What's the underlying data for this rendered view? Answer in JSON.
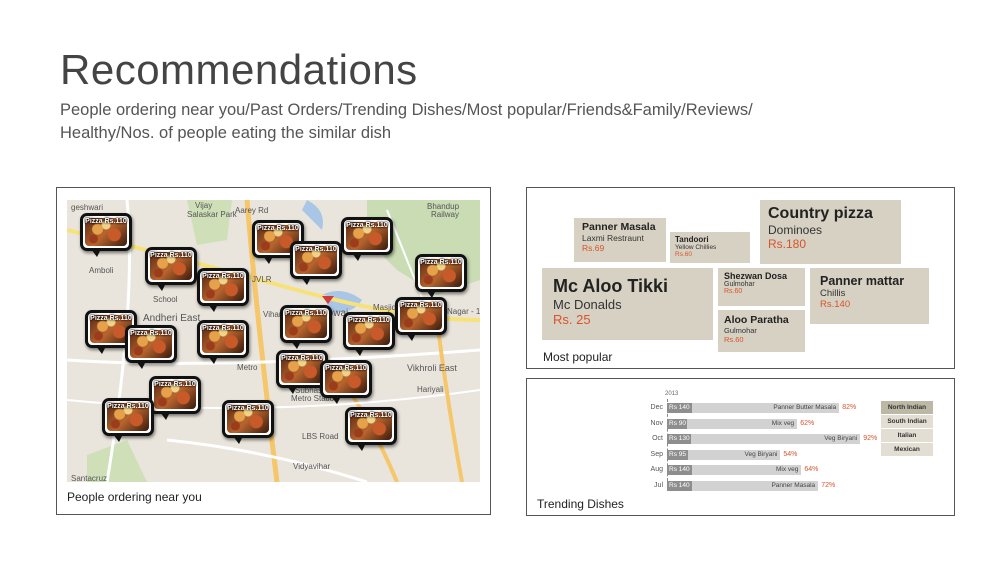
{
  "slide": {
    "title": "Recommendations",
    "subtitle_line1": "People ordering near you/Past Orders/Trending Dishes/Most popular/Friends&Family/Reviews/",
    "subtitle_line2": "Healthy/Nos. of people eating the similar dish"
  },
  "map_panel": {
    "caption": "People ordering near you",
    "pin_label": "Pizza Rs.110",
    "labels": {
      "l1": "geshwari",
      "l2": "Vijay",
      "l3": "Salaskar Park",
      "l4": "Aarey Rd",
      "l5": "Bhandup",
      "l6": "Railway",
      "l7": "Amboli",
      "l8": "Andheri East",
      "l9": "Powai",
      "l10": "School",
      "l11": "JVLR",
      "l12": "Masjid",
      "l13": "Nagar - 1",
      "l14": "Vikhroli East",
      "l15": "Metro",
      "l16": "Subhash",
      "l17": "Metro Station",
      "l18": "Hariyali",
      "l19": "LBS Road",
      "l20": "Vidyavihar",
      "l21": "East",
      "l22": "Santacruz",
      "l23": "Vihar Rd"
    }
  },
  "popular_panel": {
    "caption": "Most popular",
    "tiles": [
      {
        "dish": "Panner Masala",
        "restaurant": "Laxmi Restraunt",
        "price": "Rs.69"
      },
      {
        "dish": "Tandoori",
        "restaurant": "Yellow Chillies",
        "price": "Rs.60"
      },
      {
        "dish": "Country pizza",
        "restaurant": "Dominoes",
        "price": "Rs.180"
      },
      {
        "dish": "Mc Aloo Tikki",
        "restaurant": "Mc Donalds",
        "price": "Rs. 25"
      },
      {
        "dish": "Shezwan Dosa",
        "restaurant": "Gulmohar",
        "price": "Rs.60"
      },
      {
        "dish": "Panner mattar",
        "restaurant": "Chillis",
        "price": "Rs.140"
      },
      {
        "dish": "Aloo Paratha",
        "restaurant": "Gulmohar",
        "price": "Rs.60"
      }
    ]
  },
  "trending_panel": {
    "caption": "Trending Dishes",
    "year": "2013",
    "rows": [
      {
        "month": "Dec",
        "price_label": "Rs 140",
        "price": 140,
        "dish": "Panner Butter Masala",
        "percent_label": "82%",
        "percent": 82
      },
      {
        "month": "Nov",
        "price_label": "Rs  90",
        "price": 90,
        "dish": "Mix veg",
        "percent_label": "62%",
        "percent": 62
      },
      {
        "month": "Oct",
        "price_label": "Rs 130",
        "price": 130,
        "dish": "Veg Biryani",
        "percent_label": "92%",
        "percent": 92
      },
      {
        "month": "Sep",
        "price_label": "Rs  95",
        "price": 95,
        "dish": "Veg Biryani",
        "percent_label": "54%",
        "percent": 54
      },
      {
        "month": "Aug",
        "price_label": "Rs 140",
        "price": 140,
        "dish": "Mix veg",
        "percent_label": "64%",
        "percent": 64
      },
      {
        "month": "Jul",
        "price_label": "Rs 140",
        "price": 140,
        "dish": "Panner Masala",
        "percent_label": "72%",
        "percent": 72
      }
    ],
    "legend": [
      {
        "label": "North Indian",
        "color": "#bdb7a6"
      },
      {
        "label": "South Indian",
        "color": "#e2ded3"
      },
      {
        "label": "Italian",
        "color": "#e2ded3"
      },
      {
        "label": "Mexican",
        "color": "#e2ded3"
      }
    ],
    "colors": {
      "price_bar": "#8e8e8e",
      "dish_bar": "#d2d2d2",
      "percent_text": "#d9532b"
    }
  }
}
